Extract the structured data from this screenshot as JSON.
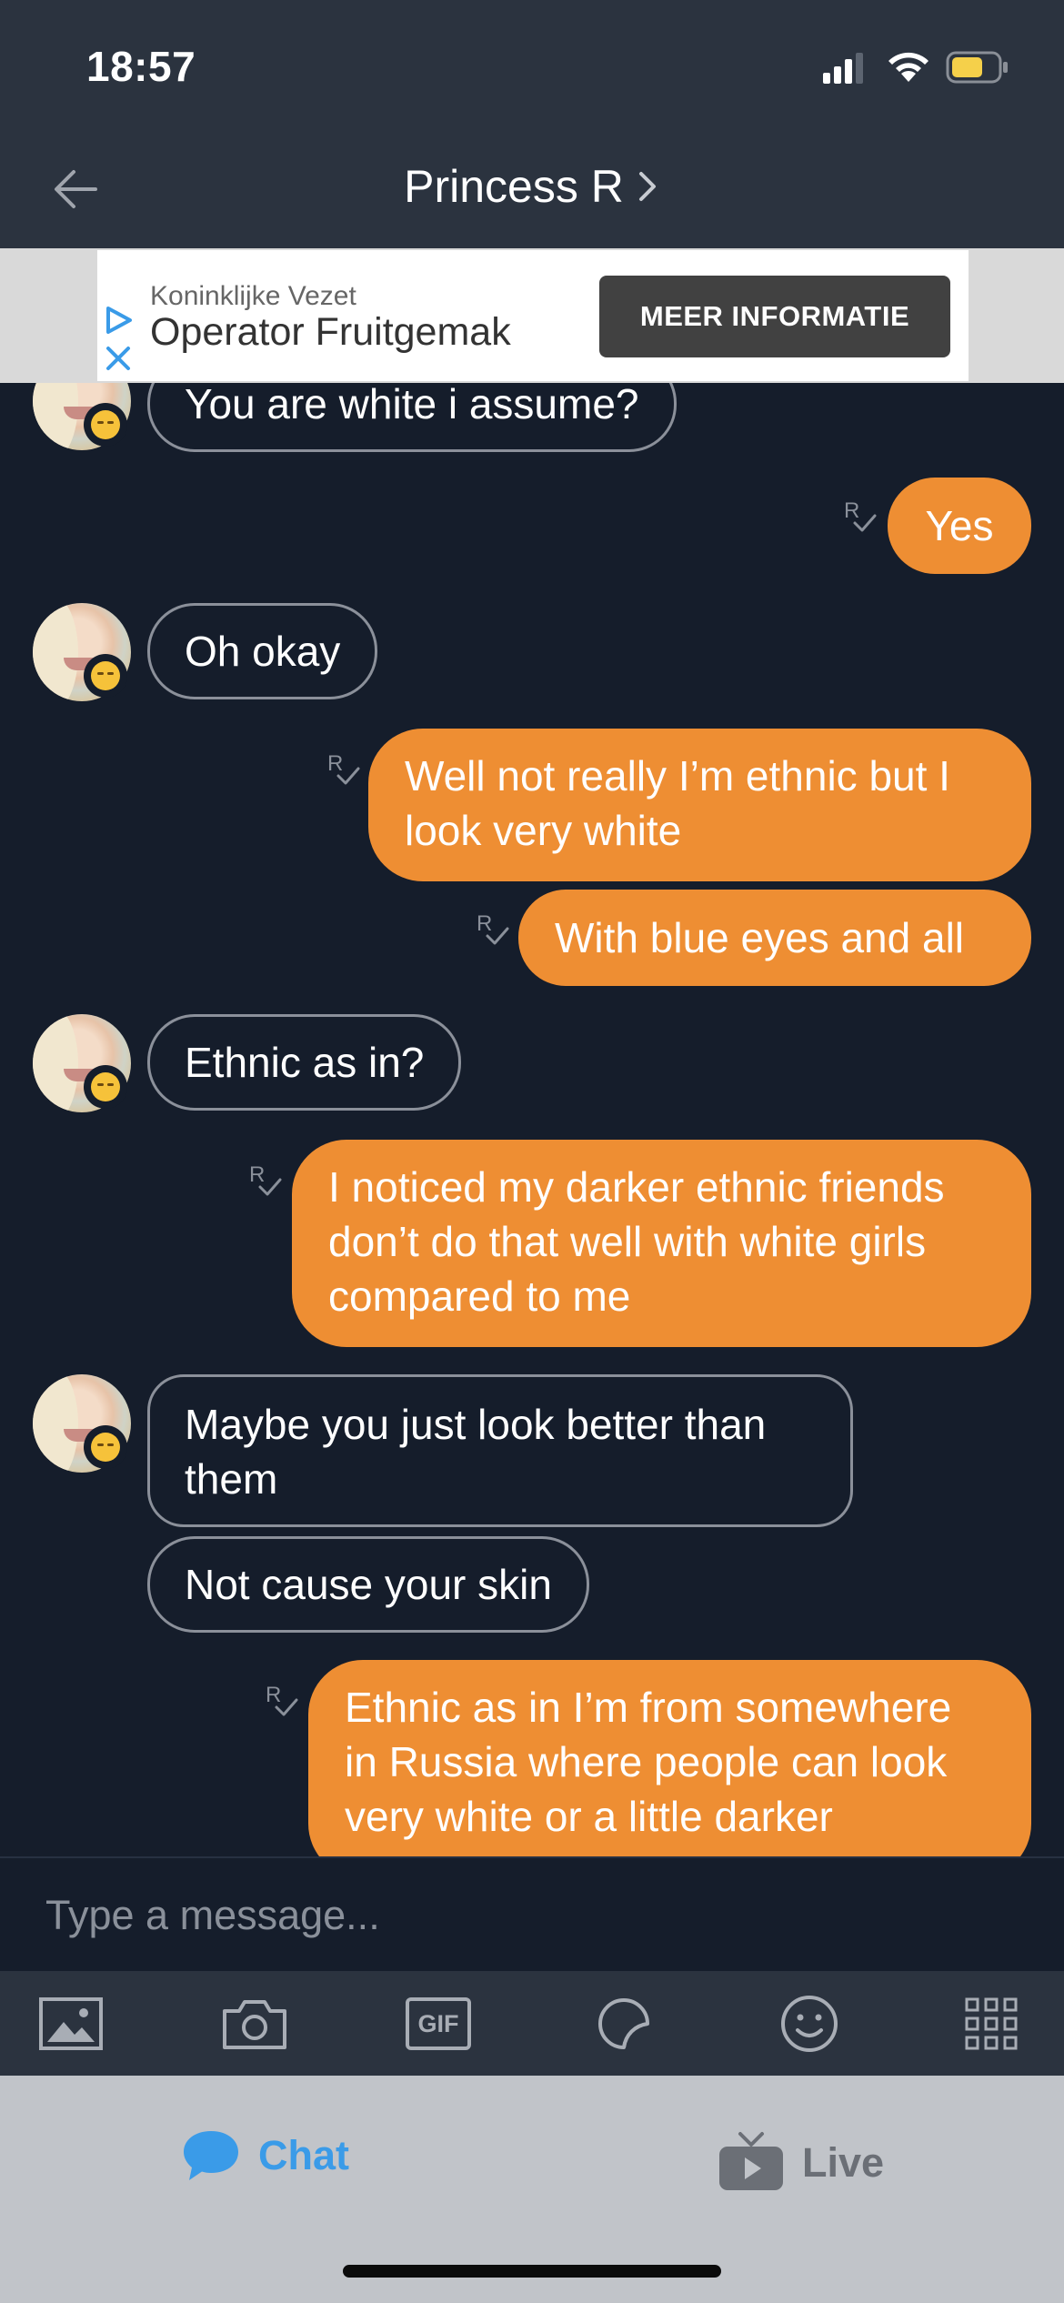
{
  "status_bar": {
    "time": "18:57"
  },
  "header": {
    "title": "Princess R"
  },
  "ad": {
    "advertiser": "Koninklijke Vezet",
    "title": "Operator Fruitgemak",
    "cta_label": "MEER INFORMATIE"
  },
  "read_receipt_label": "R",
  "messages": [
    {
      "from": "them",
      "text": "You are white i assume?"
    },
    {
      "from": "me",
      "text": "Yes"
    },
    {
      "from": "them",
      "text": "Oh okay"
    },
    {
      "from": "me",
      "text": "Well not really I’m ethnic but I look very white"
    },
    {
      "from": "me",
      "text": "With blue eyes and all"
    },
    {
      "from": "them",
      "text": "Ethnic as in?"
    },
    {
      "from": "me",
      "text": "I noticed my darker ethnic friends don’t do that well with white girls compared to me"
    },
    {
      "from": "them",
      "text": "Maybe you just look better than them"
    },
    {
      "from": "them",
      "text": "Not cause your skin"
    },
    {
      "from": "me",
      "text": "Ethnic as in I’m from somewhere in Russia where people can look very white or a little darker"
    }
  ],
  "composer": {
    "placeholder": "Type a message..."
  },
  "toolbar": {
    "gif_label": "GIF",
    "icons": [
      "image-icon",
      "camera-icon",
      "gif-icon",
      "sticker-icon",
      "emoji-icon",
      "grid-icon"
    ]
  },
  "tabs": [
    {
      "label": "Chat",
      "icon": "chat-bubble-icon",
      "color": "#3a9be8",
      "active": true
    },
    {
      "label": "Live",
      "icon": "tv-icon",
      "color": "#6b6f76",
      "active": false
    }
  ],
  "colors": {
    "outgoing_bubble": "#ee8e33",
    "background": "#151d2b",
    "header": "#2b333f",
    "tabbar": "#c1c4c9",
    "accent": "#3a9be8"
  }
}
